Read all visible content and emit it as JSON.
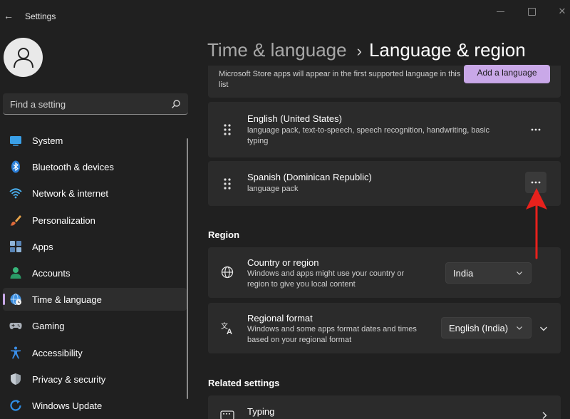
{
  "window": {
    "title": "Settings"
  },
  "search": {
    "placeholder": "Find a setting"
  },
  "sidebar": {
    "items": [
      {
        "label": "System",
        "icon": "system-icon"
      },
      {
        "label": "Bluetooth & devices",
        "icon": "bluetooth-icon"
      },
      {
        "label": "Network & internet",
        "icon": "wifi-icon"
      },
      {
        "label": "Personalization",
        "icon": "brush-icon"
      },
      {
        "label": "Apps",
        "icon": "apps-icon"
      },
      {
        "label": "Accounts",
        "icon": "person-icon"
      },
      {
        "label": "Time & language",
        "icon": "globe-clock-icon",
        "active": true
      },
      {
        "label": "Gaming",
        "icon": "gamepad-icon"
      },
      {
        "label": "Accessibility",
        "icon": "accessibility-icon"
      },
      {
        "label": "Privacy & security",
        "icon": "shield-icon"
      },
      {
        "label": "Windows Update",
        "icon": "update-icon"
      }
    ]
  },
  "breadcrumb": {
    "parent": "Time & language",
    "separator": "›",
    "current": "Language & region"
  },
  "preferred": {
    "description": "Microsoft Store apps will appear in the first supported language in this list",
    "add_button": "Add a language",
    "languages": [
      {
        "name": "English (United States)",
        "features": "language pack, text-to-speech, speech recognition, handwriting, basic typing"
      },
      {
        "name": "Spanish (Dominican Republic)",
        "features": "language pack"
      }
    ]
  },
  "region": {
    "heading": "Region",
    "country": {
      "title": "Country or region",
      "description": "Windows and apps might use your country or region to give you local content",
      "value": "India"
    },
    "format": {
      "title": "Regional format",
      "description": "Windows and some apps format dates and times based on your regional format",
      "value": "English (India)"
    }
  },
  "related": {
    "heading": "Related settings",
    "typing": "Typing"
  },
  "colors": {
    "accent": "#c9a8e8",
    "annotation_arrow": "#e8211c",
    "background": "#202020",
    "card": "#2b2b2b"
  }
}
